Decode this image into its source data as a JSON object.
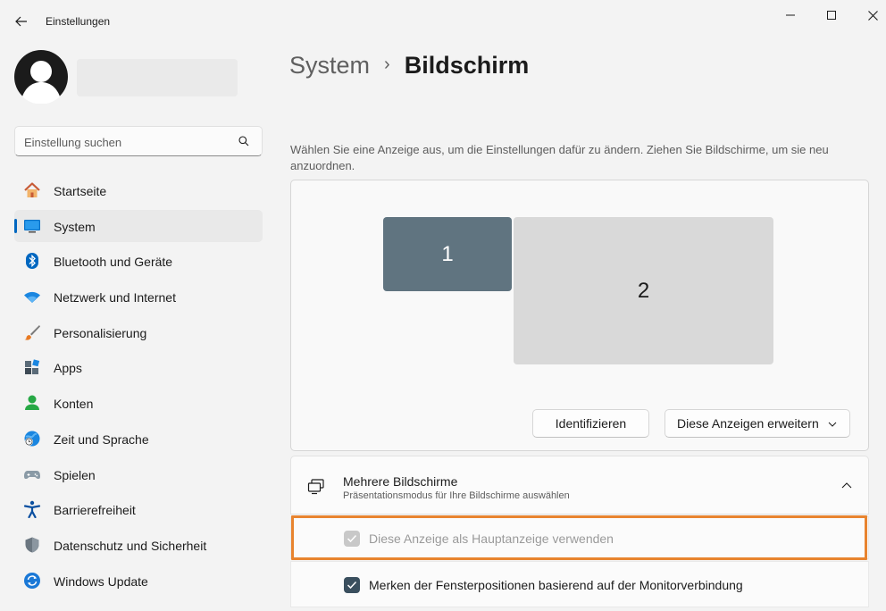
{
  "window": {
    "title": "Einstellungen"
  },
  "search": {
    "placeholder": "Einstellung suchen"
  },
  "sidebar": {
    "items": [
      {
        "label": "Startseite",
        "icon": "home-icon"
      },
      {
        "label": "System",
        "icon": "display-icon",
        "selected": true
      },
      {
        "label": "Bluetooth und Geräte",
        "icon": "bluetooth-icon"
      },
      {
        "label": "Netzwerk und Internet",
        "icon": "wifi-icon"
      },
      {
        "label": "Personalisierung",
        "icon": "brush-icon"
      },
      {
        "label": "Apps",
        "icon": "apps-icon"
      },
      {
        "label": "Konten",
        "icon": "person-icon"
      },
      {
        "label": "Zeit und Sprache",
        "icon": "globe-clock-icon"
      },
      {
        "label": "Spielen",
        "icon": "gamepad-icon"
      },
      {
        "label": "Barrierefreiheit",
        "icon": "accessibility-icon"
      },
      {
        "label": "Datenschutz und Sicherheit",
        "icon": "shield-icon"
      },
      {
        "label": "Windows Update",
        "icon": "update-icon"
      }
    ]
  },
  "breadcrumb": {
    "parent": "System",
    "separator": "›",
    "current": "Bildschirm"
  },
  "main": {
    "description": "Wählen Sie eine Anzeige aus, um die Einstellungen dafür zu ändern. Ziehen Sie Bildschirme, um sie neu anzuordnen.",
    "monitors": [
      {
        "label": "1",
        "selected": true
      },
      {
        "label": "2",
        "selected": false
      }
    ],
    "identify_label": "Identifizieren",
    "mode_dropdown": {
      "selected": "Diese Anzeigen erweitern"
    },
    "multiple_displays": {
      "title": "Mehrere Bildschirme",
      "subtitle": "Präsentationsmodus für Ihre Bildschirme auswählen",
      "expanded": true
    },
    "options": [
      {
        "label": "Diese Anzeige als Hauptanzeige verwenden",
        "checked": true,
        "disabled": true
      },
      {
        "label": "Merken der Fensterpositionen basierend auf der Monitorverbindung",
        "checked": true,
        "disabled": false
      }
    ]
  },
  "colors": {
    "accent": "#0067c0",
    "highlight": "#e8842f",
    "monitor_selected": "#607480"
  }
}
